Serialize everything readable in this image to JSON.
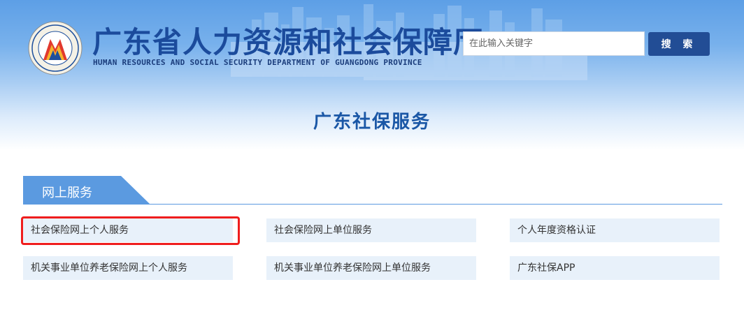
{
  "header": {
    "site_title": "广东省人力资源和社会保障厅",
    "site_subtitle": "HUMAN RESOURCES AND SOCIAL SECURITY DEPARTMENT OF GUANGDONG PROVINCE",
    "emblem_icon": "hrss-emblem-icon",
    "search": {
      "placeholder": "在此输入关键字",
      "button_label": "搜 索"
    }
  },
  "page": {
    "title": "广东社保服务"
  },
  "section": {
    "tab_label": "网上服务",
    "services": [
      "社会保险网上个人服务",
      "社会保险网上单位服务",
      "个人年度资格认证",
      "机关事业单位养老保险网上个人服务",
      "机关事业单位养老保险网上单位服务",
      "广东社保APP"
    ],
    "highlighted_index": 0
  },
  "colors": {
    "brand_blue": "#1b4b9c",
    "title_blue": "#1a57a6",
    "button_bg": "#224d95",
    "tab_blue": "#5b9ae0",
    "link_bg": "#e8f1fa",
    "highlight_red": "#ef1d1d"
  }
}
